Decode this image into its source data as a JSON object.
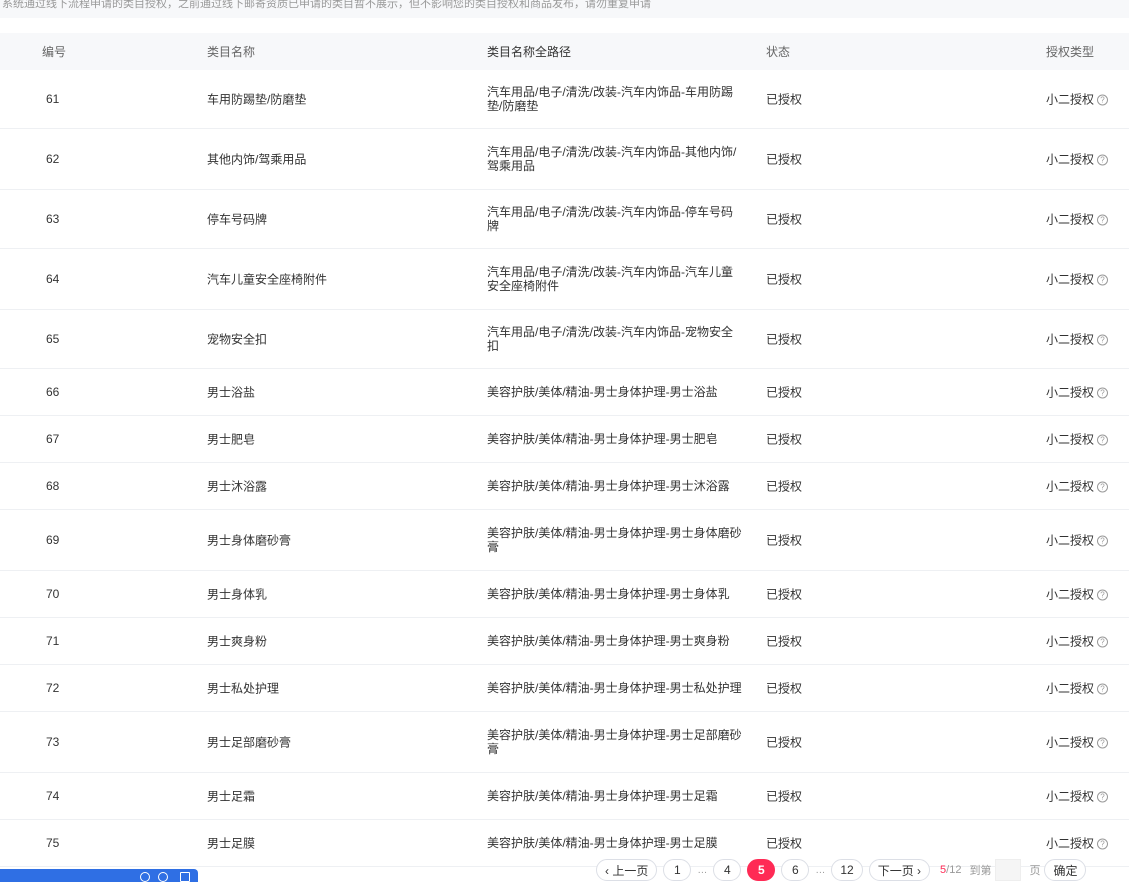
{
  "notice": "系统通过线下流程申请的类目授权，之前通过线下邮寄资质已申请的类目暂不展示，但不影响您的类目授权和商品发布，请勿重复申请",
  "headers": {
    "id": "编号",
    "name": "类目名称",
    "path": "类目名称全路径",
    "status": "状态",
    "auth": "授权类型"
  },
  "rows": [
    {
      "id": "61",
      "name": "车用防踢垫/防磨垫",
      "path": "汽车用品/电子/清洗/改装-汽车内饰品-车用防踢垫/防磨垫",
      "status": "已授权",
      "auth": "小二授权"
    },
    {
      "id": "62",
      "name": "其他内饰/驾乘用品",
      "path": "汽车用品/电子/清洗/改装-汽车内饰品-其他内饰/驾乘用品",
      "status": "已授权",
      "auth": "小二授权"
    },
    {
      "id": "63",
      "name": "停车号码牌",
      "path": "汽车用品/电子/清洗/改装-汽车内饰品-停车号码牌",
      "status": "已授权",
      "auth": "小二授权"
    },
    {
      "id": "64",
      "name": "汽车儿童安全座椅附件",
      "path": "汽车用品/电子/清洗/改装-汽车内饰品-汽车儿童安全座椅附件",
      "status": "已授权",
      "auth": "小二授权"
    },
    {
      "id": "65",
      "name": "宠物安全扣",
      "path": "汽车用品/电子/清洗/改装-汽车内饰品-宠物安全扣",
      "status": "已授权",
      "auth": "小二授权"
    },
    {
      "id": "66",
      "name": "男士浴盐",
      "path": "美容护肤/美体/精油-男士身体护理-男士浴盐",
      "status": "已授权",
      "auth": "小二授权"
    },
    {
      "id": "67",
      "name": "男士肥皂",
      "path": "美容护肤/美体/精油-男士身体护理-男士肥皂",
      "status": "已授权",
      "auth": "小二授权"
    },
    {
      "id": "68",
      "name": "男士沐浴露",
      "path": "美容护肤/美体/精油-男士身体护理-男士沐浴露",
      "status": "已授权",
      "auth": "小二授权"
    },
    {
      "id": "69",
      "name": "男士身体磨砂膏",
      "path": "美容护肤/美体/精油-男士身体护理-男士身体磨砂膏",
      "status": "已授权",
      "auth": "小二授权"
    },
    {
      "id": "70",
      "name": "男士身体乳",
      "path": "美容护肤/美体/精油-男士身体护理-男士身体乳",
      "status": "已授权",
      "auth": "小二授权"
    },
    {
      "id": "71",
      "name": "男士爽身粉",
      "path": "美容护肤/美体/精油-男士身体护理-男士爽身粉",
      "status": "已授权",
      "auth": "小二授权"
    },
    {
      "id": "72",
      "name": "男士私处护理",
      "path": "美容护肤/美体/精油-男士身体护理-男士私处护理",
      "status": "已授权",
      "auth": "小二授权"
    },
    {
      "id": "73",
      "name": "男士足部磨砂膏",
      "path": "美容护肤/美体/精油-男士身体护理-男士足部磨砂膏",
      "status": "已授权",
      "auth": "小二授权"
    },
    {
      "id": "74",
      "name": "男士足霜",
      "path": "美容护肤/美体/精油-男士身体护理-男士足霜",
      "status": "已授权",
      "auth": "小二授权"
    },
    {
      "id": "75",
      "name": "男士足膜",
      "path": "美容护肤/美体/精油-男士身体护理-男士足膜",
      "status": "已授权",
      "auth": "小二授权"
    }
  ],
  "pagination": {
    "prev": "‹ 上一页",
    "pages": [
      "1",
      "…",
      "4",
      "5",
      "6",
      "…",
      "12"
    ],
    "current": "5",
    "next": "下一页 ›",
    "info_current": "5",
    "info_total": "/12",
    "goto_label": "到第",
    "page_unit": "页",
    "confirm": "确定"
  },
  "colors": {
    "accent": "#ff2a55",
    "header_bg": "#f7f8fa"
  }
}
